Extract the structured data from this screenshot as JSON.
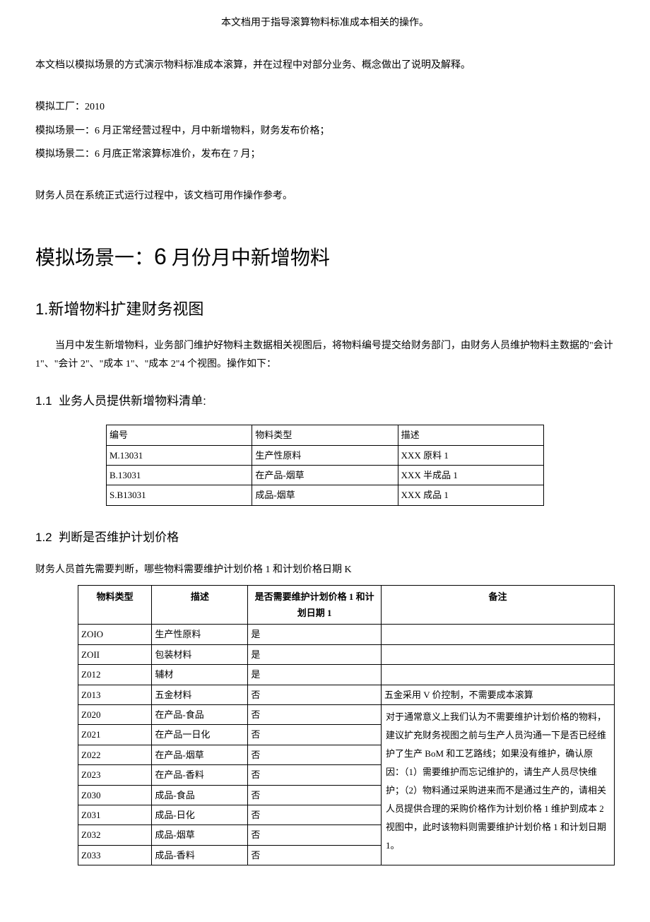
{
  "doc_title": "本文档用于指导滚算物料标准成本相关的操作。",
  "intro_para": "本文档以模拟场景的方式演示物料标准成本滚算，并在过程中对部分业务、概念做出了说明及解释。",
  "sim_factory_label": "模拟工厂：",
  "sim_factory_value": "2010",
  "sim_scenario1": "模拟场景一：6 月正常经营过程中，月中新增物料，财务发布价格；",
  "sim_scenario2": "模拟场景二：6 月底正常滚算标准价，发布在 7 月；",
  "finance_note": "财务人员在系统正式运行过程中，该文档可用作操作参考。",
  "heading1": {
    "prefix": "模拟场景一：",
    "num": "6",
    "suffix": " 月份月中新增物料"
  },
  "heading2": {
    "num": "1.",
    "text": "新增物料扩建财务视图"
  },
  "body_1": "当月中发生新增物料，业务部门维护好物料主数据相关视图后，将物料编号提交给财务部门，由财务人员维护物料主数据的\"会计 1\"、\"会计 2\"、\"成本 1\"、\"成本 2\"4 个视图。操作如下：",
  "heading3_1": {
    "num": "1.1",
    "text": "业务人员提供新增物料清单:"
  },
  "table1": {
    "headers": [
      "编号",
      "物料类型",
      "描述"
    ],
    "rows": [
      [
        "M.13031",
        "生产性原料",
        "XXX 原料 1"
      ],
      [
        "B.13031",
        "在产品-烟草",
        "XXX 半成品 1"
      ],
      [
        "S.B13031",
        "成品-烟草",
        "XXX 成品 1"
      ]
    ]
  },
  "heading3_2": {
    "num": "1.2",
    "text": "判断是否维护计划价格"
  },
  "body_2": "财务人员首先需要判断，哪些物料需要维护计划价格 1 和计划价格日期 K",
  "table2": {
    "headers": [
      "物料类型",
      "描述",
      "是否需要维护计划价格 1 和计划日期 1",
      "备注"
    ],
    "rows": [
      {
        "type": "ZOIO",
        "desc": "生产性原料",
        "need": "是",
        "note": ""
      },
      {
        "type": "ZOII",
        "desc": "包装材料",
        "need": "是",
        "note": ""
      },
      {
        "type": "Z012",
        "desc": "辅材",
        "need": "是",
        "note": ""
      },
      {
        "type": "Z013",
        "desc": "五金材料",
        "need": "否",
        "note": "五金采用 V 价控制，不需要成本滚算"
      },
      {
        "type": "Z020",
        "desc": "在产品-食品",
        "need": "否"
      },
      {
        "type": "Z021",
        "desc": "在产品一日化",
        "need": "否"
      },
      {
        "type": "Z022",
        "desc": "在产品-烟草",
        "need": "否"
      },
      {
        "type": "Z023",
        "desc": "在产品-香料",
        "need": "否"
      },
      {
        "type": "Z030",
        "desc": "成品-食品",
        "need": "否"
      },
      {
        "type": "Z031",
        "desc": "成品-日化",
        "need": "否"
      },
      {
        "type": "Z032",
        "desc": "成品-烟草",
        "need": "否"
      },
      {
        "type": "Z033",
        "desc": "成品-香料",
        "need": "否"
      }
    ],
    "merged_note": "对于通常意义上我们认为不需要维护计划价格的物料，建议扩充财务视图之前与生产人员沟通一下是否已经维护了生产 BoM 和工艺路线；如果没有维护，确认原因：（1）需要维护而忘记维护的，请生产人员尽快维护；（2）物料通过采购进来而不是通过生产的，请相关人员提供合理的采购价格作为计划价格 1 维护到成本 2 视图中，此时该物料则需要维护计划价格 1 和计划日期 1。"
  }
}
